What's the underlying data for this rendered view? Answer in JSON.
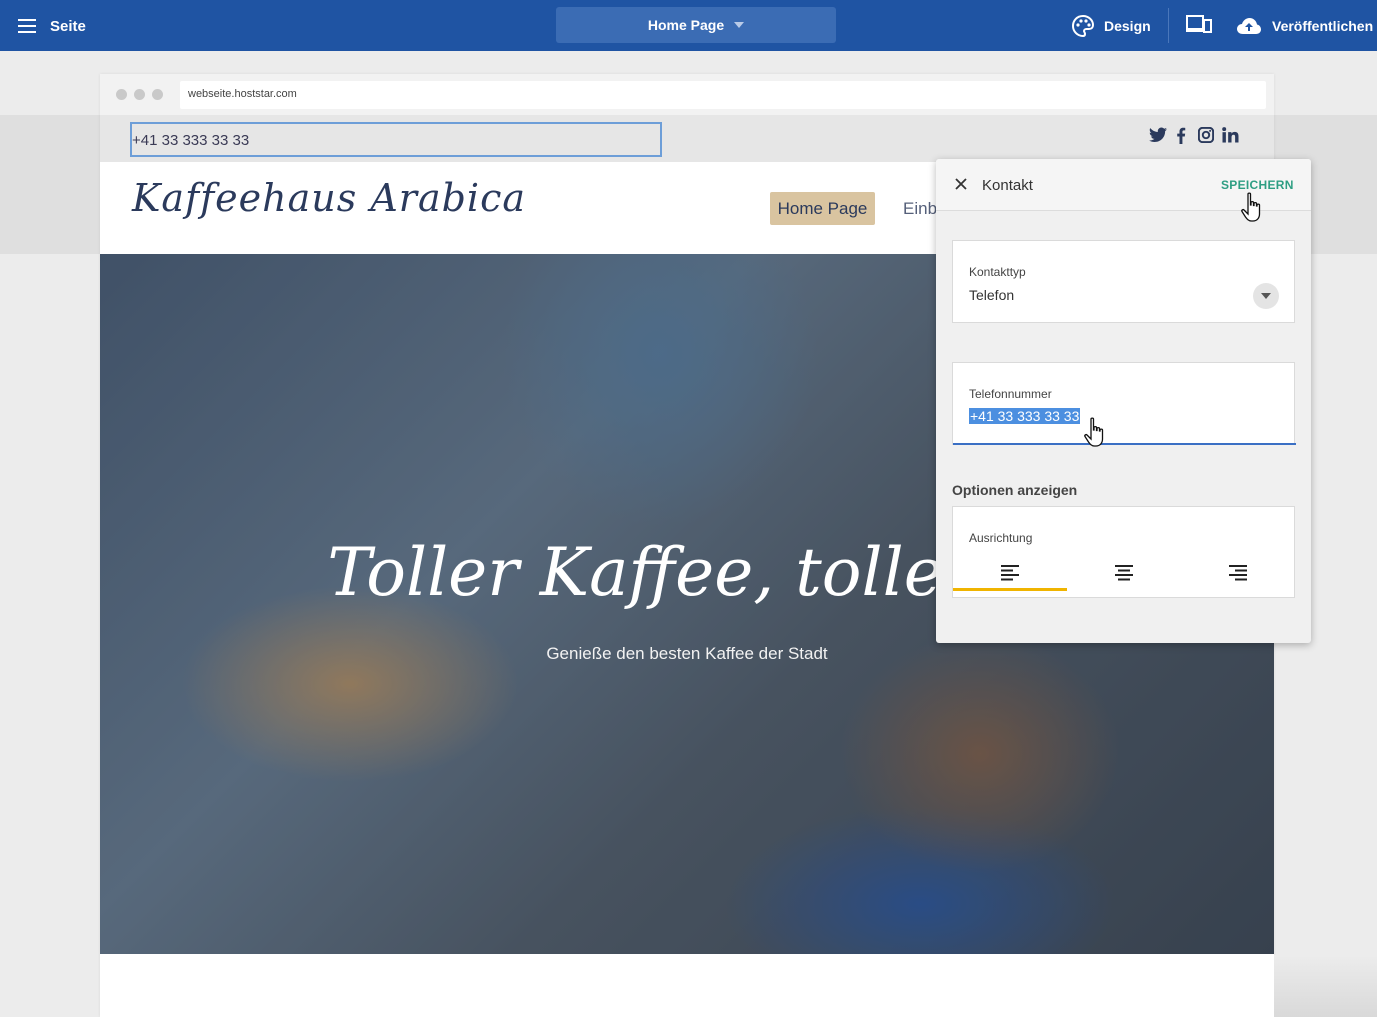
{
  "toolbar": {
    "menu_label": "Seite",
    "page_select_label": "Home Page",
    "design_label": "Design",
    "publish_label": "Veröffentlichen"
  },
  "browser": {
    "url": "webseite.hoststar.com"
  },
  "site": {
    "phone": "+41 33 333 33 33",
    "logo": "Kaffeehaus Arabica",
    "nav_home": "Home Page",
    "nav_next": "Einb",
    "hero_title": "Toller Kaffee, tolle Le",
    "hero_subtitle": "Genieße den besten Kaffee der Stadt",
    "social_icons": [
      "twitter-icon",
      "facebook-icon",
      "instagram-icon",
      "linkedin-icon"
    ]
  },
  "panel": {
    "title": "Kontakt",
    "save_label": "SPEICHERN",
    "contact_type_label": "Kontakttyp",
    "contact_type_value": "Telefon",
    "phone_label": "Telefonnummer",
    "phone_value": "+41 33 333 33 33",
    "options_title": "Optionen anzeigen",
    "alignment_label": "Ausrichtung",
    "alignment_options": [
      "align-left-icon",
      "align-center-icon",
      "align-right-icon"
    ],
    "alignment_selected": "align-left-icon"
  },
  "colors": {
    "toolbar": "#1f54a3",
    "accent_save": "#2e9e83",
    "nav_active": "#d9c4a0",
    "selection": "#4c8fe0",
    "alignment_indicator": "#f0b400"
  }
}
